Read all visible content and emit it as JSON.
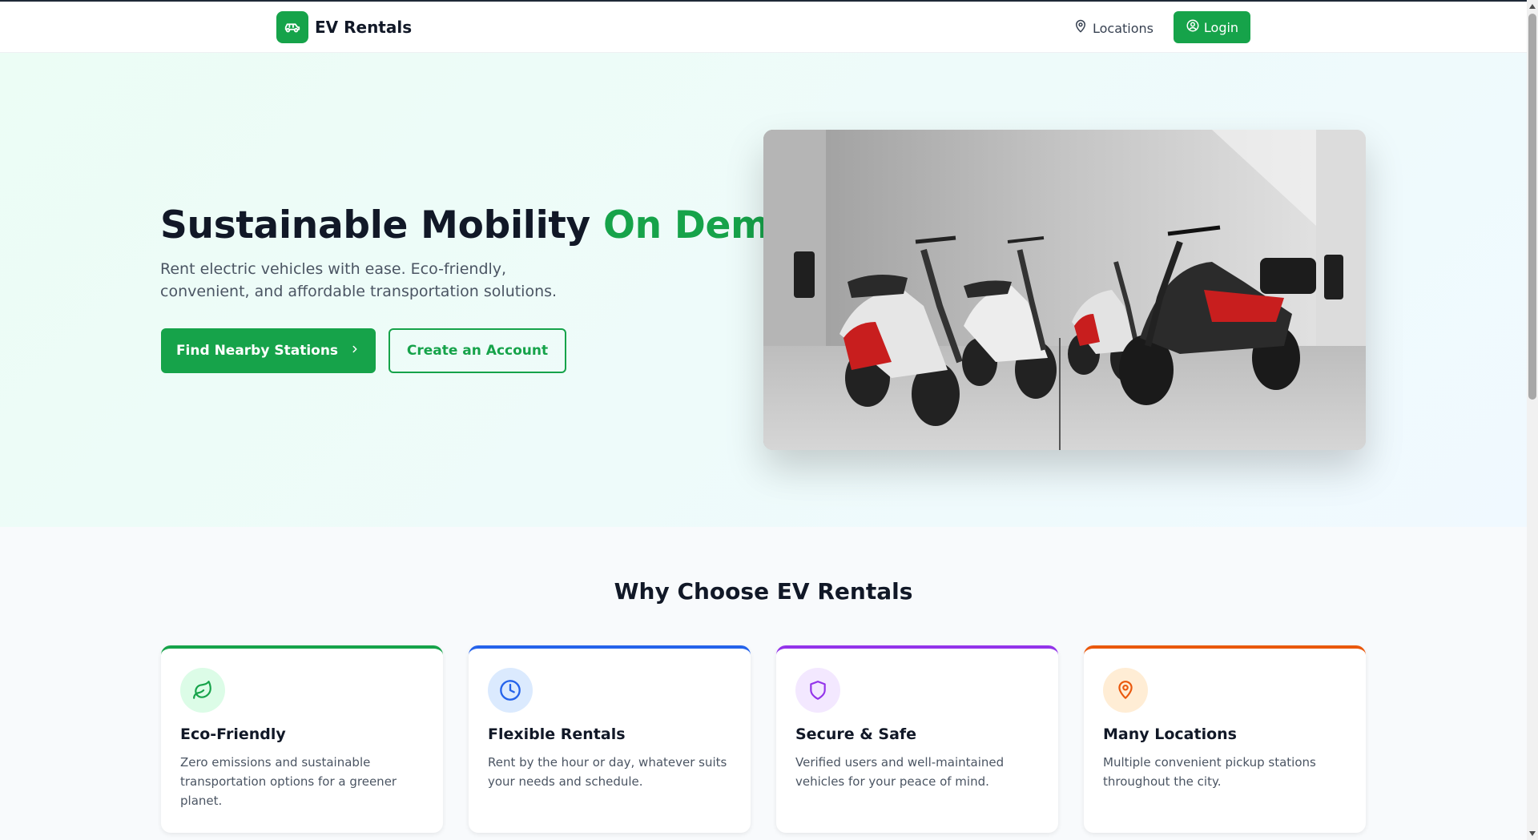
{
  "header": {
    "brand_name": "EV Rentals",
    "brand_icon": "car-icon",
    "nav_locations": "Locations",
    "nav_locations_icon": "map-pin-icon",
    "login_label": "Login",
    "login_icon": "user-circle-icon"
  },
  "hero": {
    "title_main": "Sustainable Mobility ",
    "title_accent": "On Demand",
    "subtitle": "Rent electric vehicles with ease. Eco-friendly, convenient, and affordable transportation solutions.",
    "primary_button": "Find Nearby Stations",
    "secondary_button": "Create an Account",
    "image_description_icon": "electric-scooters-image"
  },
  "features": {
    "title": "Why Choose EV Rentals",
    "cards": [
      {
        "title": "Eco-Friendly",
        "desc": "Zero emissions and sustainable transportation options for a greener planet.",
        "icon": "leaf-icon",
        "color": "#16a34a",
        "bg": "#dcfce7"
      },
      {
        "title": "Flexible Rentals",
        "desc": "Rent by the hour or day, whatever suits your needs and schedule.",
        "icon": "clock-icon",
        "color": "#2563eb",
        "bg": "#dbeafe"
      },
      {
        "title": "Secure & Safe",
        "desc": "Verified users and well-maintained vehicles for your peace of mind.",
        "icon": "shield-icon",
        "color": "#9333ea",
        "bg": "#f3e8ff"
      },
      {
        "title": "Many Locations",
        "desc": "Multiple convenient pickup stations throughout the city.",
        "icon": "map-pin-icon",
        "color": "#ea580c",
        "bg": "#ffedd5"
      }
    ]
  },
  "colors": {
    "brand": "#16a34a",
    "text": "#111827",
    "muted": "#4b5563"
  }
}
